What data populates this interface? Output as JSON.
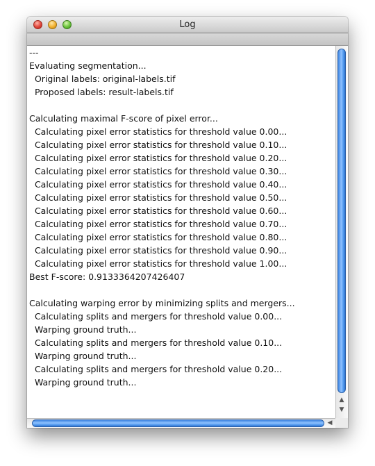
{
  "window": {
    "title": "Log"
  },
  "log": {
    "lines": [
      "---",
      "Evaluating segmentation...",
      "  Original labels: original-labels.tif",
      "  Proposed labels: result-labels.tif",
      "",
      "Calculating maximal F-score of pixel error...",
      "  Calculating pixel error statistics for threshold value 0.00...",
      "  Calculating pixel error statistics for threshold value 0.10...",
      "  Calculating pixel error statistics for threshold value 0.20...",
      "  Calculating pixel error statistics for threshold value 0.30...",
      "  Calculating pixel error statistics for threshold value 0.40...",
      "  Calculating pixel error statistics for threshold value 0.50...",
      "  Calculating pixel error statistics for threshold value 0.60...",
      "  Calculating pixel error statistics for threshold value 0.70...",
      "  Calculating pixel error statistics for threshold value 0.80...",
      "  Calculating pixel error statistics for threshold value 0.90...",
      "  Calculating pixel error statistics for threshold value 1.00...",
      "Best F-score: 0.9133364207426407",
      "",
      "Calculating warping error by minimizing splits and mergers...",
      "  Calculating splits and mergers for threshold value 0.00...",
      "  Warping ground truth...",
      "  Calculating splits and mergers for threshold value 0.10...",
      "  Warping ground truth...",
      "  Calculating splits and mergers for threshold value 0.20...",
      "  Warping ground truth..."
    ]
  },
  "icons": {
    "close": "close-icon",
    "minimize": "minimize-icon",
    "zoom": "zoom-icon",
    "scroll_up": "▲",
    "scroll_down": "▼",
    "scroll_left": "◀",
    "scroll_right": "▶"
  },
  "colors": {
    "scroll_thumb": "#5aa0f2",
    "close_button": "#e0453a",
    "minimize_button": "#f2b12f",
    "zoom_button": "#6ac43a"
  }
}
